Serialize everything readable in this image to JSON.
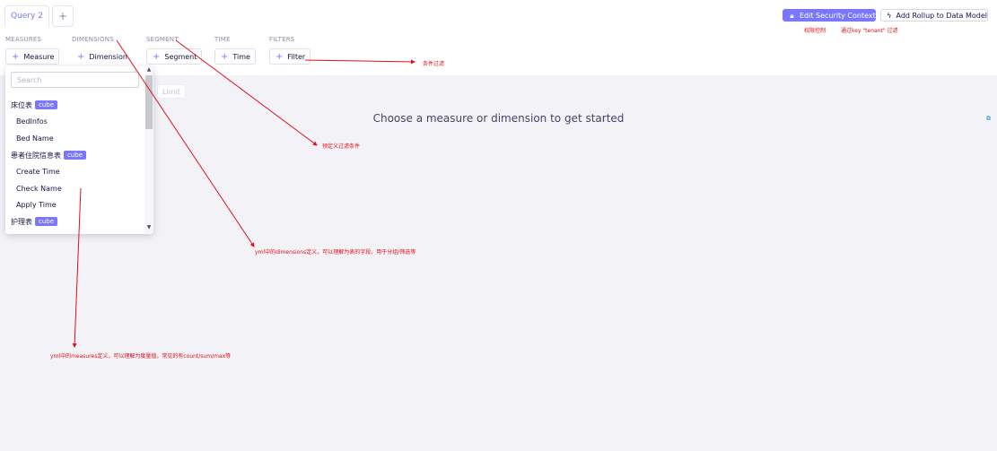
{
  "tabs": {
    "active": "Query 2",
    "add": "+"
  },
  "header": {
    "edit_security": "Edit Security Context",
    "add_rollup": "Add Rollup to Data Model"
  },
  "sections": {
    "measures": {
      "label": "MEASURES",
      "button": "Measure"
    },
    "dimensions": {
      "label": "DIMENSIONS",
      "button": "Dimension"
    },
    "segment": {
      "label": "SEGMENT",
      "button": "Segment"
    },
    "time": {
      "label": "TIME",
      "button": "Time"
    },
    "filters": {
      "label": "FILTERS",
      "button": "Filter"
    }
  },
  "limit": "Limit",
  "empty_message": "Choose a measure or dimension to get started",
  "dropdown": {
    "search_placeholder": "Search",
    "groups": [
      {
        "name": "床位表",
        "badge": "cube",
        "items": [
          "BedInfos",
          "Bed Name"
        ]
      },
      {
        "name": "患者住院信息表",
        "badge": "cube",
        "items": [
          "Create Time",
          "Check Name",
          "Apply Time"
        ]
      },
      {
        "name": "护理表",
        "badge": "cube",
        "items": []
      }
    ]
  },
  "annotations": {
    "security_note": "权限控制",
    "security_key": "通过key \"tenant\" 过滤",
    "filter_note": "条件过滤",
    "segment_note": "预定义过滤条件",
    "dimensions_note": "yml中的dimensions定义，可以理解为表的字段，用于分组/筛选等",
    "measures_note": "yml中的measures定义，可以理解为度量值，常见的有count/sum/max等"
  },
  "colors": {
    "accent": "#7a77ff",
    "annotation": "#e0101a",
    "content_bg": "#f3f3f7"
  },
  "icons": {
    "lock": "lock-icon",
    "rollup": "rollup-icon",
    "plus": "plus-icon"
  }
}
